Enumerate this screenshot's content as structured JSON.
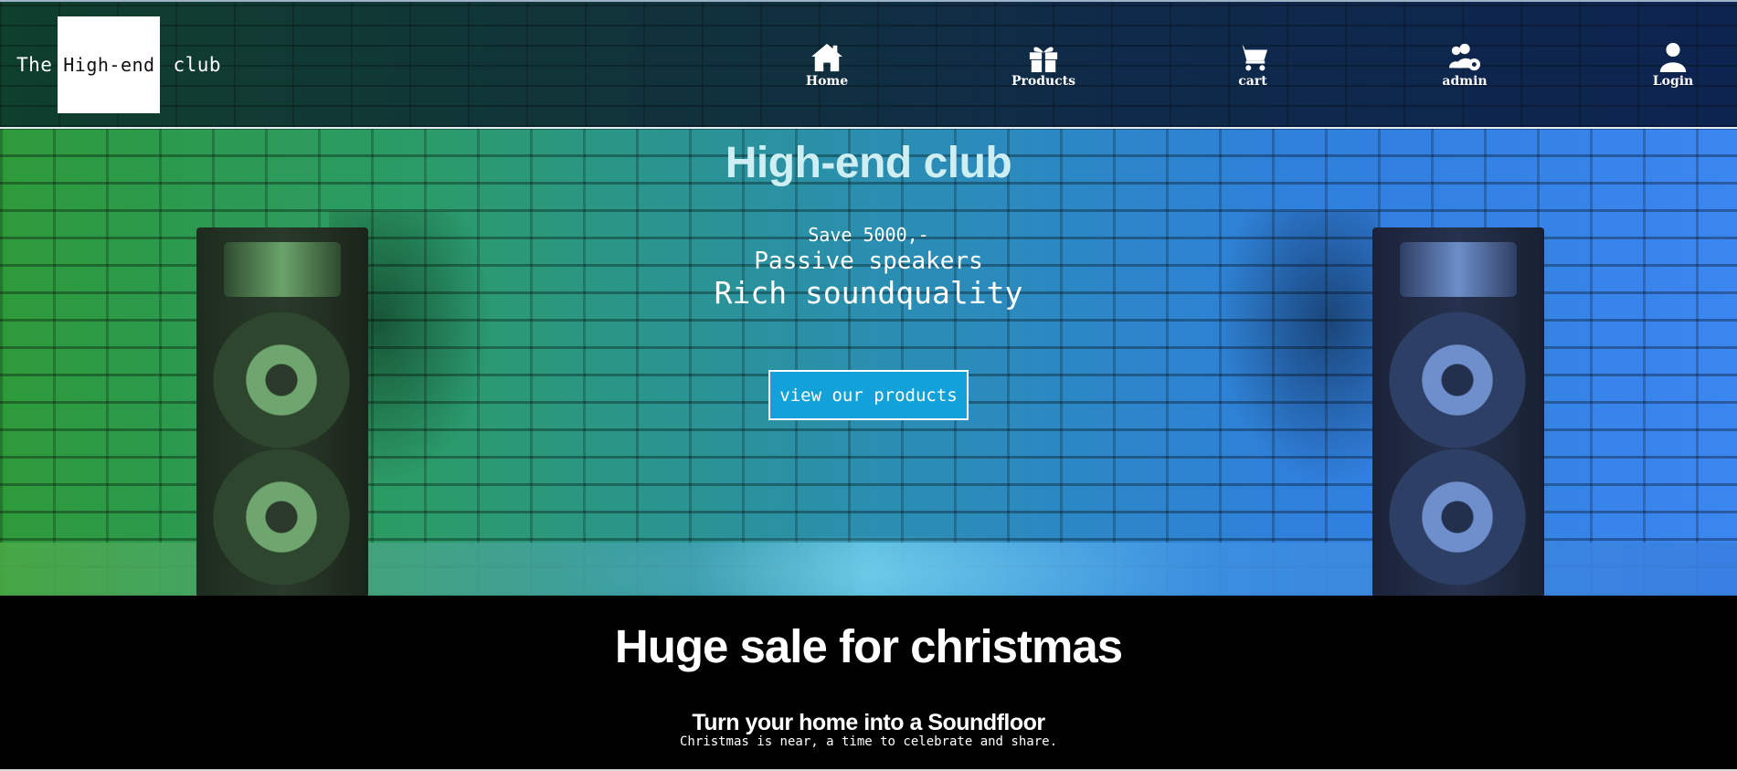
{
  "header": {
    "logo": {
      "pre": "The",
      "box": "High-end",
      "post": "club"
    },
    "nav": [
      {
        "label": "Home",
        "icon": "home-icon"
      },
      {
        "label": "Products",
        "icon": "gift-icon"
      },
      {
        "label": "cart",
        "icon": "cart-icon"
      },
      {
        "label": "admin",
        "icon": "users-cog-icon"
      },
      {
        "label": "Login",
        "icon": "user-icon"
      }
    ]
  },
  "hero": {
    "title": "High-end club",
    "line1": "Save 5000,-",
    "line2": "Passive speakers",
    "line3": "Rich soundquality",
    "cta": "view our products"
  },
  "sale": {
    "title": "Huge sale for christmas",
    "subtitle": "Turn your home into a Soundfloor",
    "text": "Christmas is near, a time to celebrate and share."
  },
  "colors": {
    "cta_bg": "#12a1d8",
    "title": "#cdeef2",
    "section_bg": "#000000"
  }
}
